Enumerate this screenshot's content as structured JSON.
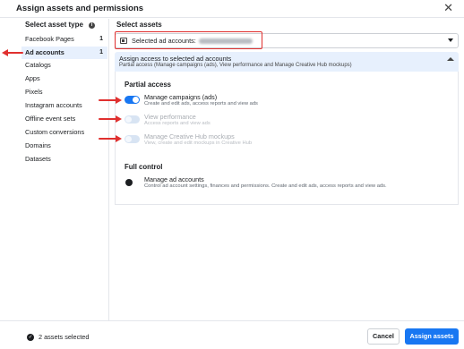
{
  "dialog": {
    "title": "Assign assets and permissions"
  },
  "left": {
    "heading": "Select asset type",
    "items": [
      {
        "label": "Facebook Pages",
        "count": "1"
      },
      {
        "label": "Ad accounts",
        "count": "1"
      },
      {
        "label": "Catalogs"
      },
      {
        "label": "Apps"
      },
      {
        "label": "Pixels"
      },
      {
        "label": "Instagram accounts"
      },
      {
        "label": "Offline event sets"
      },
      {
        "label": "Custom conversions"
      },
      {
        "label": "Domains"
      },
      {
        "label": "Datasets"
      }
    ]
  },
  "right": {
    "heading": "Select assets",
    "dropdown_label": "Selected ad accounts:"
  },
  "access": {
    "title": "Assign access to selected ad accounts",
    "subtitle": "Partial access (Manage campaigns (ads), View performance and Manage Creative Hub mockups)",
    "partial_label": "Partial access",
    "options": [
      {
        "title": "Manage campaigns (ads)",
        "desc": "Create and edit ads, access reports and view ads",
        "enabled": true
      },
      {
        "title": "View performance",
        "desc": "Access reports and view ads",
        "enabled": false
      },
      {
        "title": "Manage Creative Hub mockups",
        "desc": "View, create and edit mockups in Creative Hub",
        "enabled": false
      }
    ],
    "full_label": "Full control",
    "full_option": {
      "title": "Manage ad accounts",
      "desc": "Control ad account settings, finances and permissions. Create and edit ads, access reports and view ads."
    }
  },
  "footer": {
    "selected": "2 assets selected",
    "cancel": "Cancel",
    "assign": "Assign assets"
  },
  "colors": {
    "accent": "#1877f2",
    "annotation": "#e0302f",
    "panel": "#e7f0fd"
  },
  "icons": {
    "close": "close-icon",
    "info": "info-icon",
    "check": "check-circle-icon"
  }
}
